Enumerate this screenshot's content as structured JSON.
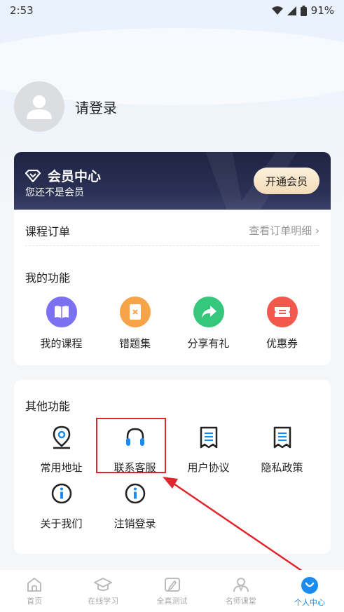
{
  "status_bar": {
    "time": "2:53",
    "battery": "91%"
  },
  "profile": {
    "login_text": "请登录"
  },
  "member": {
    "title": "会员中心",
    "subtitle": "您还不是会员",
    "button": "开通会员"
  },
  "order": {
    "title": "课程订单",
    "link": "查看订单明细"
  },
  "my_functions": {
    "title": "我的功能",
    "items": [
      {
        "label": "我的课程",
        "icon": "book-icon",
        "color": "#7b6ff2"
      },
      {
        "label": "错题集",
        "icon": "notebook-icon",
        "color": "#f6a447"
      },
      {
        "label": "分享有礼",
        "icon": "share-icon",
        "color": "#35c77c"
      },
      {
        "label": "优惠券",
        "icon": "coupon-icon",
        "color": "#f2584c"
      }
    ]
  },
  "other_functions": {
    "title": "其他功能",
    "items": [
      {
        "label": "常用地址",
        "icon": "location-icon"
      },
      {
        "label": "联系客服",
        "icon": "headset-icon"
      },
      {
        "label": "用户协议",
        "icon": "document-icon"
      },
      {
        "label": "隐私政策",
        "icon": "document-icon"
      },
      {
        "label": "关于我们",
        "icon": "info-icon"
      },
      {
        "label": "注销登录",
        "icon": "info-icon"
      }
    ]
  },
  "tabbar": {
    "items": [
      {
        "label": "首页",
        "icon": "home-icon"
      },
      {
        "label": "在线学习",
        "icon": "graduation-cap-icon"
      },
      {
        "label": "全真测试",
        "icon": "pen-paper-icon"
      },
      {
        "label": "名师课堂",
        "icon": "teacher-icon"
      },
      {
        "label": "个人中心",
        "icon": "smile-icon",
        "active": true
      }
    ]
  },
  "colors": {
    "accent": "#1a8cf0",
    "highlight": "#e0262d",
    "banner": "#252a4a"
  }
}
